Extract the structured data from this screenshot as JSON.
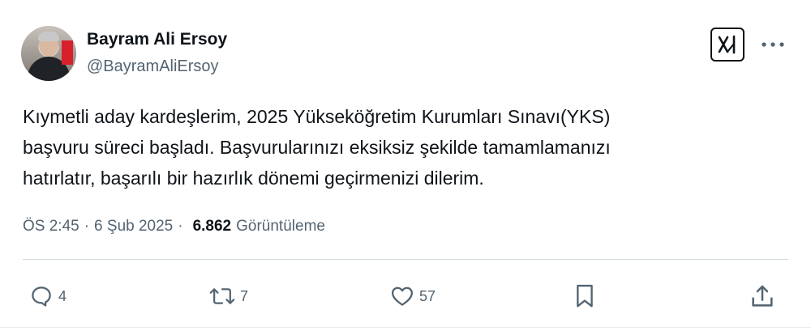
{
  "author": {
    "name": "Bayram Ali Ersoy",
    "handle": "@BayramAliErsoy"
  },
  "tweet": {
    "text": "Kıymetli aday kardeşlerim, 2025 Yükseköğretim Kurumları Sınavı(YKS)\nbaşvuru süreci başladı. Başvurularınızı eksiksiz şekilde tamamlamanızı\nhatırlatır, başarılı bir hazırlık dönemi geçirmenizi dilerim."
  },
  "meta": {
    "time": "ÖS 2:45",
    "separator1": "·",
    "date": "6 Şub 2025",
    "separator2": "·",
    "views_count": "6.862",
    "views_label": "Görüntüleme"
  },
  "actions": {
    "replies": "4",
    "reposts": "7",
    "likes": "57"
  },
  "icons": {
    "grok": "grok-icon",
    "more": "more-icon",
    "reply": "reply-icon",
    "repost": "repost-icon",
    "like": "heart-icon",
    "bookmark": "bookmark-icon",
    "share": "share-icon"
  },
  "colors": {
    "text": "#0f1419",
    "secondary": "#536471",
    "divider": "#cfd9de"
  }
}
